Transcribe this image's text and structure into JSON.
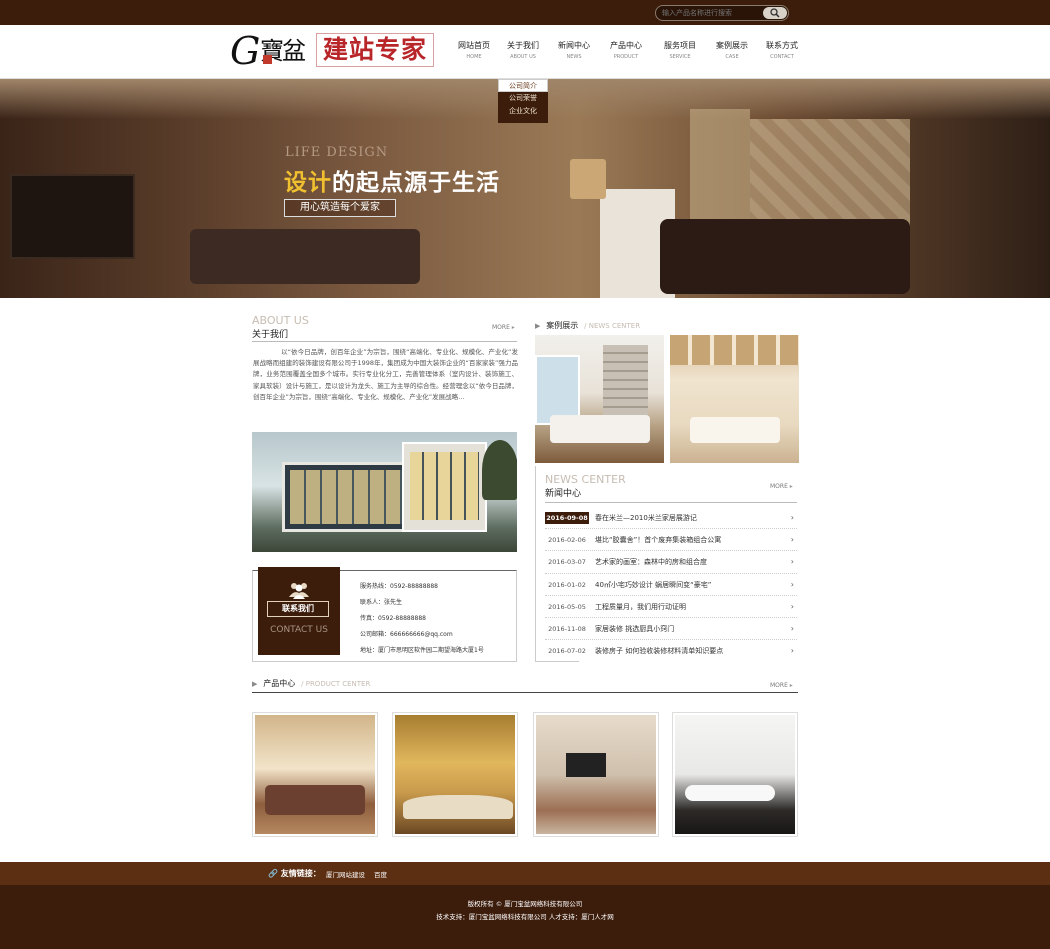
{
  "search": {
    "placeholder": "输入产品名称进行搜索"
  },
  "logo": {
    "letter": "G",
    "brand": "寶盆",
    "slogan": "建站专家"
  },
  "nav": [
    {
      "cn": "网站首页",
      "en": "HOME"
    },
    {
      "cn": "关于我们",
      "en": "ABOUT US"
    },
    {
      "cn": "新闻中心",
      "en": "NEWS"
    },
    {
      "cn": "产品中心",
      "en": "PRODUCT"
    },
    {
      "cn": "服务项目",
      "en": "SERVICE"
    },
    {
      "cn": "案例展示",
      "en": "CASE"
    },
    {
      "cn": "联系方式",
      "en": "CONTACT"
    }
  ],
  "dropdown": [
    "公司简介",
    "公司荣誉",
    "企业文化"
  ],
  "hero": {
    "en": "LIFE DESIGN",
    "slogan_hl": "设计",
    "slogan_rest": "的起点源于生活",
    "tag": "用心筑造每个爱家"
  },
  "about": {
    "en": "ABOUT US",
    "cn": "关于我们",
    "more": "MORE",
    "text": "以“依今日品牌，创百年企业”为宗旨，围绕“高端化、专业化、规模化、产业化”发展战略而组建的装饰建设有限公司于1998年，集团成为中国大装饰企业的“百家家装”强力品牌，业务范围覆盖全国多个城市。实行专业化分工，完善管理体系（室内设计、装饰施工、家具软装）设计与施工，是以设计为龙头、施工为主导的综合性。经营理念以“依今日品牌，创百年企业”为宗旨，围绕“高端化、专业化、规模化、产业化”发展战略…"
  },
  "contact": {
    "button": "联系我们",
    "en": "CONTACT US",
    "lines": [
      "服务热线：0592-88888888",
      "联系人：张先生",
      "传真：0592-88888888",
      "公司邮箱：666666666@qq.com",
      "地址：厦门市思明区软件园二期望海路大厦1号"
    ]
  },
  "cases": {
    "cn": "案例展示",
    "en": "/ NEWS CENTER"
  },
  "news": {
    "en": "NEWS CENTER",
    "cn": "新闻中心",
    "more": "MORE",
    "items": [
      {
        "date": "2016-09-08",
        "title": "春在米兰—2010米兰家居展游记"
      },
      {
        "date": "2016-02-06",
        "title": "堪比“胶囊舍”！首个废弃集装箱组合公寓"
      },
      {
        "date": "2016-03-07",
        "title": "艺术家的画室：森林中的房和组合度"
      },
      {
        "date": "2016-01-02",
        "title": "40㎡小宅巧妙设计 蜗居瞬间变“豪宅”"
      },
      {
        "date": "2016-05-05",
        "title": "工程质量月，我们用行动证明"
      },
      {
        "date": "2016-11-08",
        "title": "家居装修 挑选厨具小窍门"
      },
      {
        "date": "2016-07-02",
        "title": "装修房子 如何验收装修材料清单知识要点"
      }
    ]
  },
  "products": {
    "cn": "产品中心",
    "en": "/ PRODUCT CENTER",
    "more": "MORE"
  },
  "links": {
    "label": "友情链接：",
    "items": [
      "厦门网站建设",
      "百度"
    ]
  },
  "footer": {
    "line1": "版权所有 © 厦门宝盆网络科技有限公司",
    "line2": "技术支持：厦门宝盆网络科技有限公司 人才支持：厦门人才网"
  },
  "colors": {
    "dark_brown": "#3c1c0b",
    "link_bar": "#5c2e12",
    "highlight": "#f0c030",
    "logo_red": "#b8262a"
  }
}
